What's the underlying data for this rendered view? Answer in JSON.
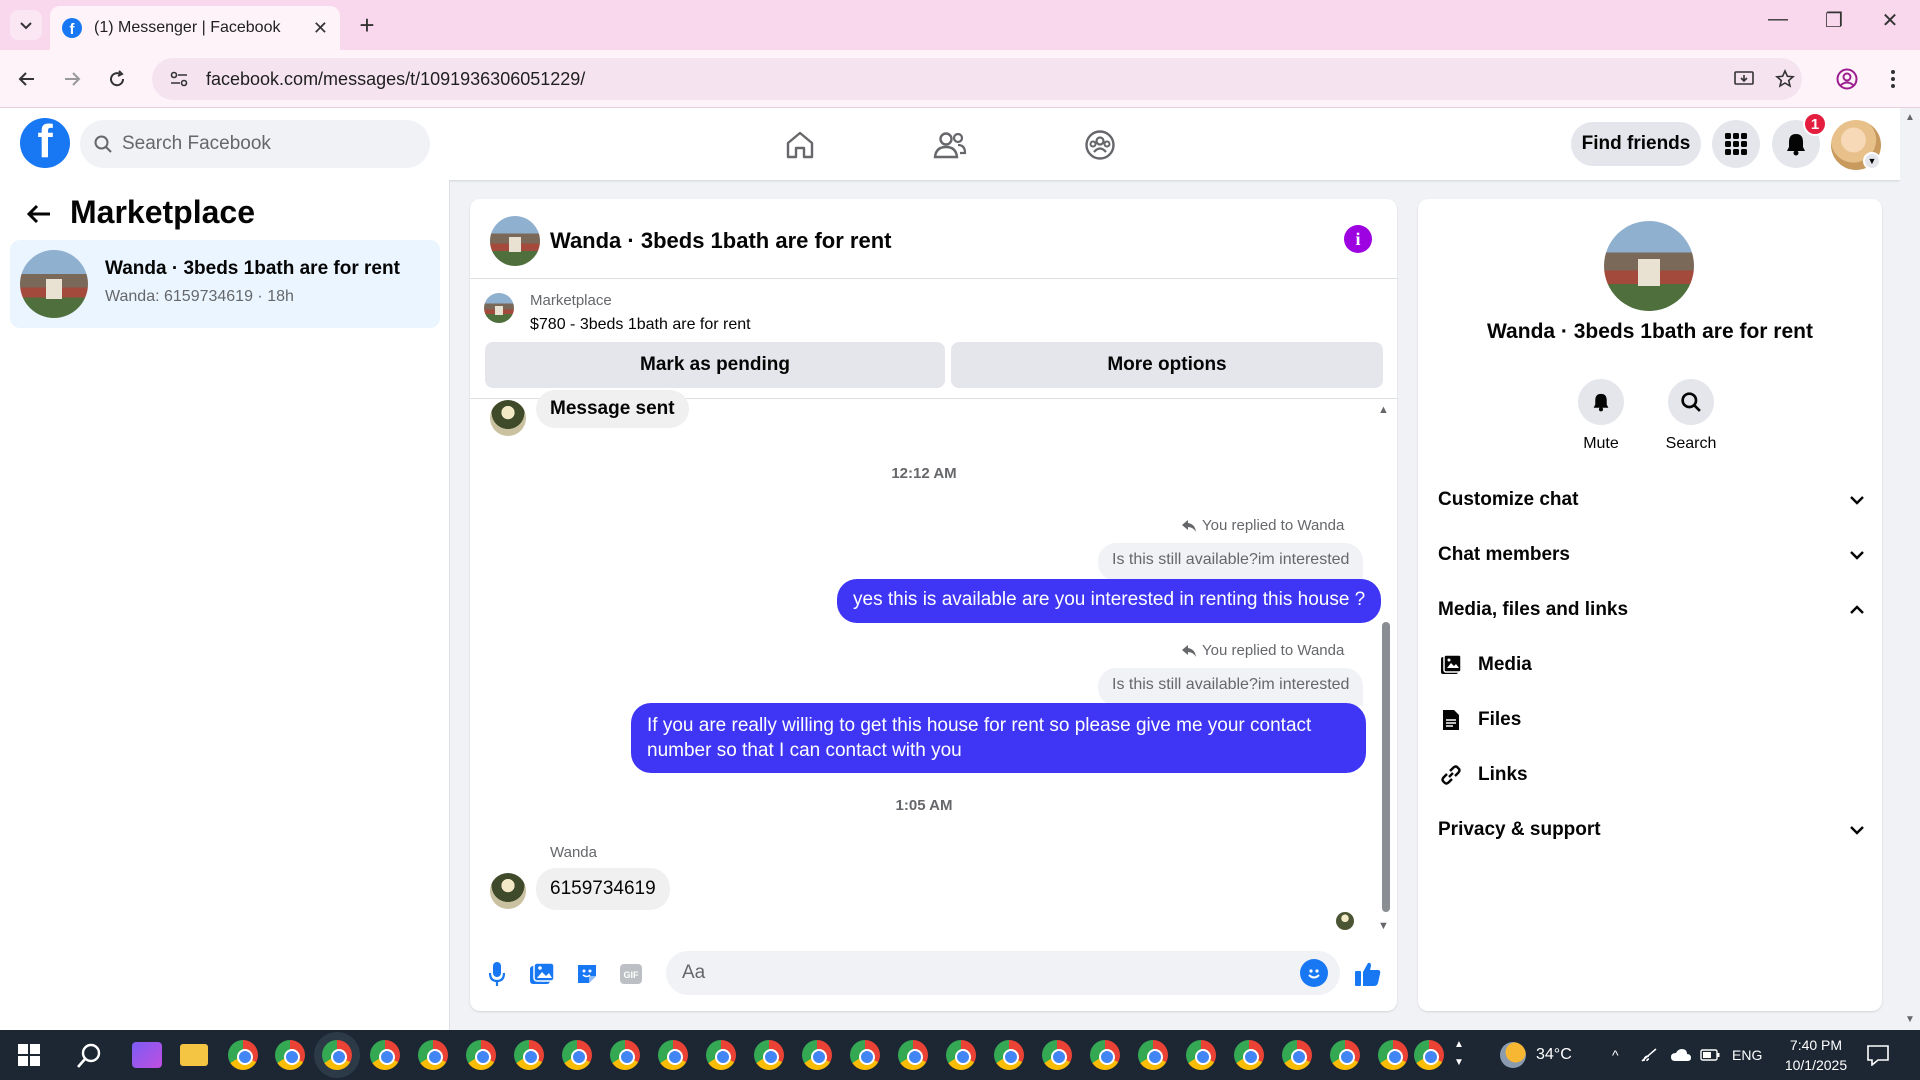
{
  "browser": {
    "tab_title": "(1) Messenger | Facebook",
    "url": "facebook.com/messages/t/1091936306051229/"
  },
  "fb_header": {
    "search_placeholder": "Search Facebook",
    "find_friends_label": "Find friends",
    "notification_count": "1"
  },
  "sidebar": {
    "title": "Marketplace",
    "conversation": {
      "name": "Wanda · 3beds 1bath are for rent",
      "snippet": "Wanda: 6159734619 · 18h"
    }
  },
  "chat": {
    "title": "Wanda · 3beds 1bath are for rent",
    "marketplace_label": "Marketplace",
    "listing": "$780 - 3beds 1bath are for rent",
    "mark_pending_label": "Mark as pending",
    "more_options_label": "More options",
    "messages": [
      {
        "type": "incoming",
        "text": "Message sent"
      },
      {
        "type": "timestamp",
        "text": "12:12 AM"
      },
      {
        "type": "reply_note",
        "text": "You replied to Wanda"
      },
      {
        "type": "quoted",
        "text": "Is this still available?im interested"
      },
      {
        "type": "outgoing",
        "text": "yes this is available are you interested in renting this house ?"
      },
      {
        "type": "reply_note",
        "text": "You replied to Wanda"
      },
      {
        "type": "quoted",
        "text": "Is this still available?im interested"
      },
      {
        "type": "outgoing",
        "text": "If you are really willing to get this house for rent so please give me your contact number so that I can  contact with you"
      },
      {
        "type": "timestamp",
        "text": "1:05 AM"
      },
      {
        "type": "sender",
        "text": "Wanda"
      },
      {
        "type": "incoming",
        "text": "6159734619"
      }
    ],
    "composer_placeholder": "Aa"
  },
  "details": {
    "title": "Wanda · 3beds 1bath are for rent",
    "mute_label": "Mute",
    "search_label": "Search",
    "sections": {
      "customize": "Customize chat",
      "members": "Chat members",
      "media_files_links": "Media, files and links",
      "media": "Media",
      "files": "Files",
      "links": "Links",
      "privacy": "Privacy & support"
    }
  },
  "taskbar": {
    "temperature": "34°C",
    "language": "ENG",
    "time": "7:40 PM",
    "date": "10/1/2025"
  },
  "colors": {
    "fb_blue": "#1877f2",
    "outgoing_bubble": "#3f35f5",
    "info_purple": "#9d02e0",
    "badge_red": "#e41e3f",
    "tab_bar": "#f9d8ee"
  }
}
